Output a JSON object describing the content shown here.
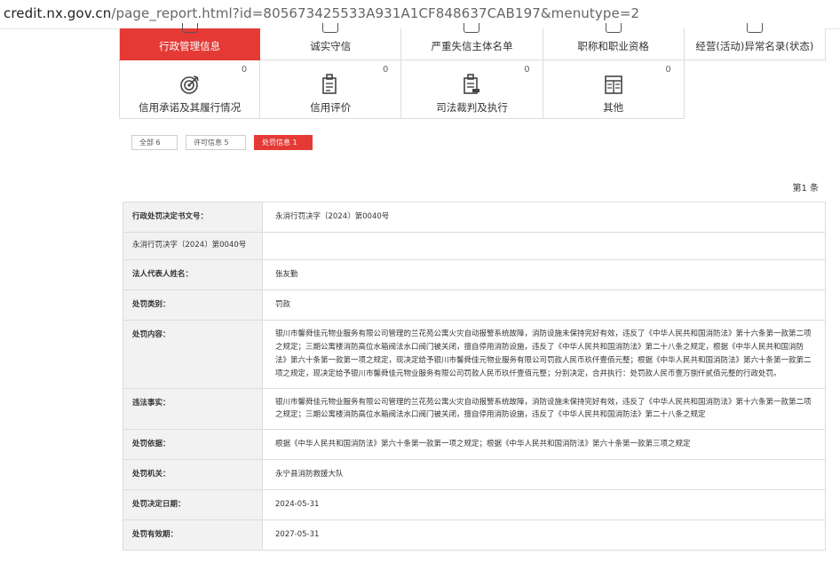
{
  "browser": {
    "url_host": "credit.nx.gov.cn",
    "url_path": "/page_report.html?id=805673425533A931A1CF848637CAB197&menutype=2"
  },
  "menu": {
    "row1": [
      {
        "label": "行政管理信息",
        "active": true
      },
      {
        "label": "诚实守信",
        "active": false
      },
      {
        "label": "严重失信主体名单",
        "active": false
      },
      {
        "label": "职称和职业资格",
        "active": false
      },
      {
        "label": "经营(活动)异常名录(状态)",
        "active": false
      }
    ],
    "row2": [
      {
        "label": "信用承诺及其履行情况",
        "count": "0",
        "icon": "target-icon"
      },
      {
        "label": "信用评价",
        "count": "0",
        "icon": "document-icon"
      },
      {
        "label": "司法裁判及执行",
        "count": "0",
        "icon": "gavel-document-icon"
      },
      {
        "label": "其他",
        "count": "0",
        "icon": "grid-document-icon"
      }
    ]
  },
  "filters": [
    {
      "label": "全部 6",
      "active": false
    },
    {
      "label": "许可信息 5",
      "active": false
    },
    {
      "label": "处罚信息 1",
      "active": true
    }
  ],
  "record_count": "第1 条",
  "detail": {
    "decision_no_label": "行政处罚决定书文号：",
    "decision_no_value": "永消行罚决字〔2024〕第0040号",
    "extra_label": "永消行罚决字〔2024〕第0040号",
    "legal_rep_label": "法人代表人姓名：",
    "legal_rep_value": "张友勤",
    "category_label": "处罚类别：",
    "category_value": "罚款",
    "content_label": "处罚内容：",
    "content_value": "银川市馨舜佳元物业服务有限公司管理的兰花苑公寓火灾自动报警系统故障，消防设施未保持完好有效，违反了《中华人民共和国消防法》第十六条第一款第二项之规定；三期公寓楼消防高位水箱阀法水口阀门被关闭，擅自停用消防设施，违反了《中华人民共和国消防法》第二十八条之规定，根据《中华人民共和国消防法》第六十条第一款第一项之规定，现决定给予银川市馨舜佳元物业服务有限公司罚款人民币玖仟壹佰元整；根据《中华人民共和国消防法》第六十条第一款第二项之规定，现决定给予银川市馨舜佳元物业服务有限公司罚款人民币玖仟壹佰元整；分别决定，合并执行：处罚款人民币壹万捌仟贰佰元整的行政处罚。",
    "facts_label": "违法事实：",
    "facts_value": "银川市馨舜佳元物业服务有限公司管理的兰花苑公寓火灾自动报警系统故障，消防设施未保持完好有效，违反了《中华人民共和国消防法》第十六条第一款第二项之规定；三期公寓楼消防高位水箱阀法水口阀门被关闭，擅自停用消防设施，违反了《中华人民共和国消防法》第二十八条之规定",
    "basis_label": "处罚依据：",
    "basis_value": "根据《中华人民共和国消防法》第六十条第一款第一项之规定；根据《中华人民共和国消防法》第六十条第一款第三项之规定",
    "authority_label": "处罚机关：",
    "authority_value": "永宁县消防救援大队",
    "date_label": "处罚决定日期：",
    "date_value": "2024-05-31",
    "valid_label": "处罚有效期：",
    "valid_value": "2027-05-31"
  }
}
